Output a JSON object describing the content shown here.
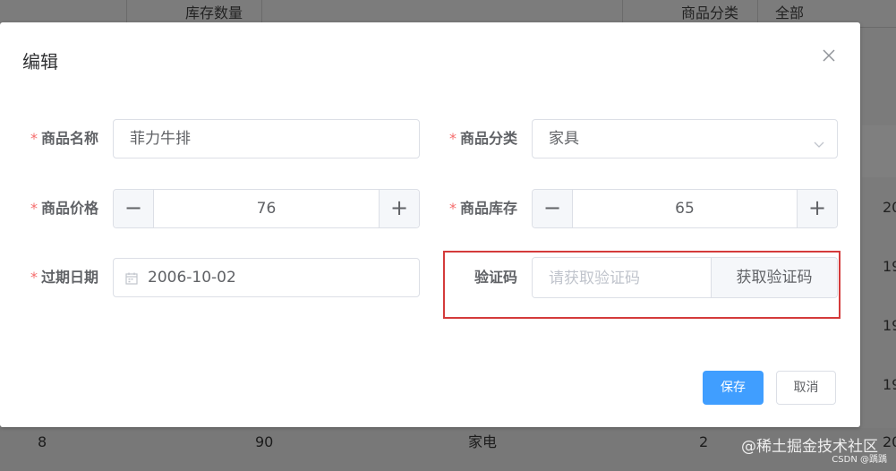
{
  "background": {
    "header": {
      "stock_col": "库存数量",
      "category_col": "商品分类",
      "filter": "全部"
    },
    "right_column": [
      "20",
      "19",
      "19",
      "19",
      "19"
    ],
    "bottom_row": {
      "id": "8",
      "stock": "90",
      "category": "家电",
      "num": "2",
      "extra": "20"
    },
    "watermark": "@稀土掘金技术社区",
    "watermark_small": "CSDN @踽踽"
  },
  "dialog": {
    "title": "编辑",
    "close_icon": "close-icon",
    "fields": {
      "name": {
        "label": "商品名称",
        "value": "菲力牛排"
      },
      "category": {
        "label": "商品分类",
        "value": "家具"
      },
      "price": {
        "label": "商品价格",
        "value": "76",
        "minus": "−",
        "plus": "+"
      },
      "stock": {
        "label": "商品库存",
        "value": "65",
        "minus": "−",
        "plus": "+"
      },
      "expiry": {
        "label": "过期日期",
        "value": "2006-10-02"
      },
      "code": {
        "label": "验证码",
        "placeholder": "请获取验证码",
        "button": "获取验证码"
      }
    },
    "required_mark": "*",
    "footer": {
      "save": "保存",
      "cancel": "取消"
    }
  },
  "colors": {
    "primary": "#409eff",
    "required": "#f56c6c",
    "highlight_border": "#d43b3b"
  }
}
